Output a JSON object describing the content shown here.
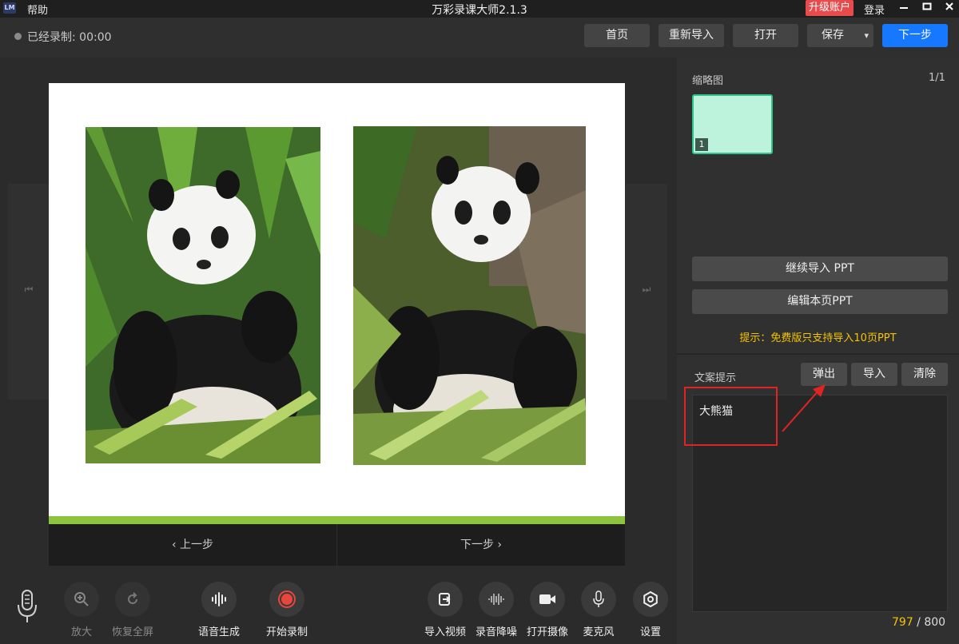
{
  "titlebar": {
    "logo": "LM",
    "help": "帮助",
    "title": "万彩录课大师2.1.3",
    "upgrade": "升级账户",
    "login": "登录"
  },
  "toolbar": {
    "recorded_label": "已经录制: 00:00",
    "home": "首页",
    "reimport": "重新导入",
    "open": "打开",
    "save": "保存",
    "next": "下一步"
  },
  "slide_nav": {
    "prev": "上一步",
    "next": "下一步"
  },
  "tools": {
    "zoom_in": "放大",
    "restore": "恢复全屏",
    "voice_gen": "语音生成",
    "start_record": "开始录制",
    "import_video": "导入视频",
    "denoise": "录音降噪",
    "camera": "打开摄像",
    "mic": "麦克风",
    "settings": "设置"
  },
  "thumbnails": {
    "title": "缩略图",
    "count": "1/1",
    "items": [
      {
        "num": "1"
      }
    ]
  },
  "ppt_actions": {
    "continue_import": "继续导入 PPT",
    "edit_page": "编辑本页PPT",
    "tip": "提示：免费版只支持导入10页PPT"
  },
  "script": {
    "title": "文案提示",
    "popup": "弹出",
    "import": "导入",
    "clear": "清除",
    "text": "大熊猫",
    "used": "797",
    "max": " / 800"
  },
  "colors": {
    "accent": "#1677ff",
    "upgrade": "#e84b4b",
    "tip": "#f5c400",
    "slide_bar": "#8cc43d",
    "thumb": "#bdf2dc",
    "highlight": "#e02424"
  }
}
